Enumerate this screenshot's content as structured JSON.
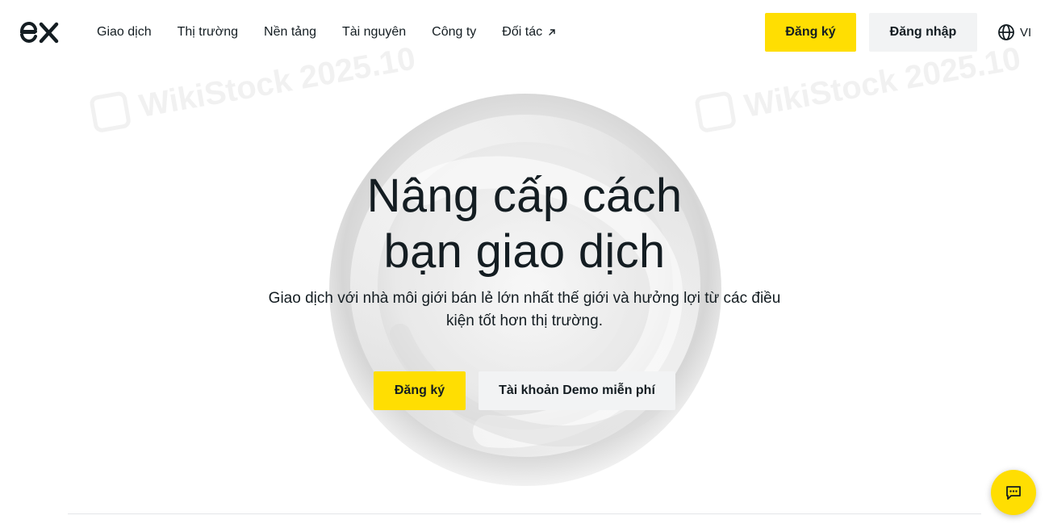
{
  "header": {
    "logo_text": "ex",
    "nav": [
      {
        "label": "Giao dịch"
      },
      {
        "label": "Thị trường"
      },
      {
        "label": "Nền tảng"
      },
      {
        "label": "Tài nguyên"
      },
      {
        "label": "Công ty"
      },
      {
        "label": "Đối tác",
        "icon": "external-arrow-icon"
      }
    ],
    "signup_label": "Đăng ký",
    "login_label": "Đăng nhập",
    "language": "VI",
    "language_icon": "globe-icon"
  },
  "hero": {
    "title_line1": "Nâng cấp cách",
    "title_line2": "bạn giao dịch",
    "subtitle_line1": "Giao dịch với nhà môi giới bán lẻ lớn nhất thế giới và hưởng lợi từ các điều",
    "subtitle_line2": "kiện tốt hơn thị trường.",
    "signup_label": "Đăng ký",
    "demo_label": "Tài khoản Demo miễn phí"
  },
  "watermark": {
    "text": "WikiStock 2025.10"
  },
  "chat": {
    "icon": "chat-icon"
  },
  "colors": {
    "accent": "#ffde02",
    "text": "#141d22",
    "secondary_button": "#f2f3f4"
  }
}
